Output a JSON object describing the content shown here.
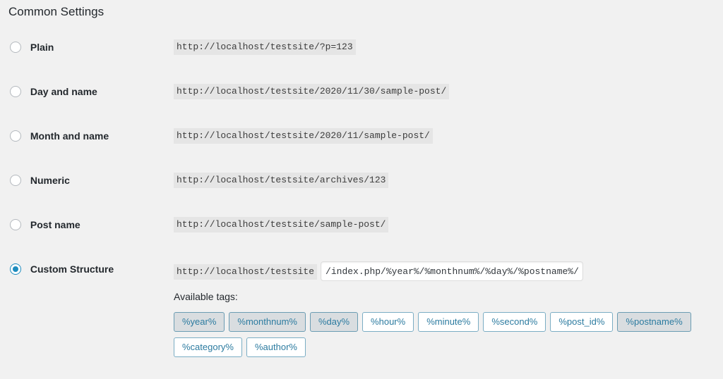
{
  "page": {
    "title": "Common Settings"
  },
  "options": [
    {
      "id": "plain",
      "label": "Plain",
      "url": "http://localhost/testsite/?p=123",
      "selected": false
    },
    {
      "id": "day-and-name",
      "label": "Day and name",
      "url": "http://localhost/testsite/2020/11/30/sample-post/",
      "selected": false
    },
    {
      "id": "month-and-name",
      "label": "Month and name",
      "url": "http://localhost/testsite/2020/11/sample-post/",
      "selected": false
    },
    {
      "id": "numeric",
      "label": "Numeric",
      "url": "http://localhost/testsite/archives/123",
      "selected": false
    },
    {
      "id": "post-name",
      "label": "Post name",
      "url": "http://localhost/testsite/sample-post/",
      "selected": false
    }
  ],
  "custom_structure": {
    "label": "Custom Structure",
    "prefix": "http://localhost/testsite",
    "value": "/index.php/%year%/%monthnum%/%day%/%postname%/",
    "selected": true
  },
  "available_tags": {
    "label": "Available tags:",
    "tags": [
      {
        "label": "%year%",
        "active": true
      },
      {
        "label": "%monthnum%",
        "active": true
      },
      {
        "label": "%day%",
        "active": true
      },
      {
        "label": "%hour%",
        "active": false
      },
      {
        "label": "%minute%",
        "active": false
      },
      {
        "label": "%second%",
        "active": false
      },
      {
        "label": "%post_id%",
        "active": false
      },
      {
        "label": "%postname%",
        "active": true
      },
      {
        "label": "%category%",
        "active": false
      },
      {
        "label": "%author%",
        "active": false
      }
    ]
  },
  "colors": {
    "background": "#f1f1f1",
    "code_background": "#e5e5e5",
    "accent": "#1e8cbe",
    "tag_border": "#7badc4",
    "tag_text": "#2c7ba0",
    "tag_active_background": "#d9dde0"
  }
}
